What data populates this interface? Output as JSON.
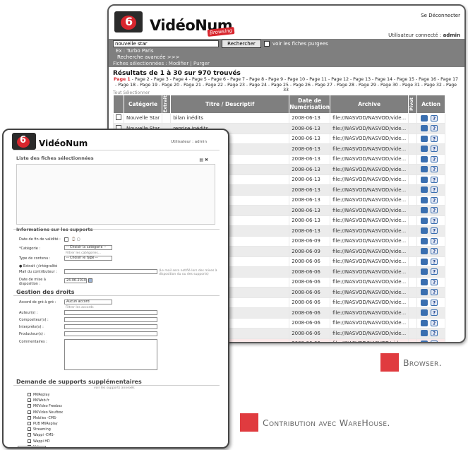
{
  "browser": {
    "logout": "Se Déconnecter",
    "brand": "VidéoNum",
    "brand_sub": "Browsing",
    "user_label": "Utilisateur connecté :",
    "user_name": "admin",
    "search_value": "nouvelle star",
    "search_button": "Rechercher",
    "purge_label": "voir les fiches purgees",
    "example": "Ex : Turbo Paris",
    "advanced": "Recherche avancée >>>",
    "selected_label": "Fiches sélectionnées :",
    "selected_actions": "Modifier | Purger",
    "results_title": "Résultats de 1 à 30 sur 970 trouvés",
    "pages_text": "Page 1 - Page 2 - Page 3 - Page 4 - Page 5 - Page 6 - Page 7 - Page 8 - Page 9 - Page 10 - Page 11 - Page 12 - Page 13 - Page 14 - Page 15 - Page 16 - Page 17 - Page 18 - Page 19 - Page 20 - Page 21 - Page 22 - Page 23 - Page 24 - Page 25 - Page 26 - Page 27 - Page 28 - Page 29 - Page 30 - Page 31 - Page 32 - Page 33",
    "current_page": "Page 1",
    "select_all": "Tout Sélectionner",
    "columns": {
      "category": "Catégorie",
      "extract": "Extrait",
      "title": "Titre / Descriptif",
      "date": "Date de Numérisation",
      "archive": "Archive",
      "pivot": "Pivot",
      "action": "Action"
    },
    "rows": [
      {
        "category": "Nouvelle Star",
        "title": "bilan inédits",
        "date": "2008-06-13",
        "archive": "file://NASVOD/NASVOD/vide..."
      },
      {
        "category": "Nouvelle Star",
        "title": "reprise inédits",
        "date": "2008-06-13",
        "archive": "file://NASVOD/NASVOD/vide..."
      },
      {
        "category": "",
        "title": "",
        "date": "2008-06-13",
        "archive": "file://NASVOD/NASVOD/vide..."
      },
      {
        "category": "",
        "title": "",
        "date": "2008-06-13",
        "archive": "file://NASVOD/NASVOD/vide..."
      },
      {
        "category": "",
        "title": "",
        "date": "2008-06-13",
        "archive": "file://NASVOD/NASVOD/vide..."
      },
      {
        "category": "",
        "title": "",
        "date": "2008-06-13",
        "archive": "file://NASVOD/NASVOD/vide..."
      },
      {
        "category": "",
        "title": "",
        "date": "2008-06-13",
        "archive": "file://NASVOD/NASVOD/vide..."
      },
      {
        "category": "",
        "title": "",
        "date": "2008-06-13",
        "archive": "file://NASVOD/NASVOD/vide..."
      },
      {
        "category": "",
        "title": "",
        "date": "2008-06-13",
        "archive": "file://NASVOD/NASVOD/vide..."
      },
      {
        "category": "",
        "title": "",
        "date": "2008-06-13",
        "archive": "file://NASVOD/NASVOD/vide..."
      },
      {
        "category": "",
        "title": "",
        "date": "2008-06-13",
        "archive": "file://NASVOD/NASVOD/vide..."
      },
      {
        "category": "",
        "title": "",
        "date": "2008-06-13",
        "archive": "file://NASVOD/NASVOD/vide..."
      },
      {
        "category": "",
        "title": "",
        "date": "2008-06-09",
        "archive": "file://NASVOD/NASVOD/vide..."
      },
      {
        "category": "",
        "title": "",
        "date": "2008-06-09",
        "archive": "file://NASVOD/NASVOD/vide..."
      },
      {
        "category": "",
        "title": "",
        "date": "2008-06-06",
        "archive": "file://NASVOD/NASVOD/vide..."
      },
      {
        "category": "",
        "title": "",
        "date": "2008-06-06",
        "archive": "file://NASVOD/NASVOD/vide..."
      },
      {
        "category": "",
        "title": "",
        "date": "2008-06-06",
        "archive": "file://NASVOD/NASVOD/vide..."
      },
      {
        "category": "",
        "title": "",
        "date": "2008-06-06",
        "archive": "file://NASVOD/NASVOD/vide..."
      },
      {
        "category": "",
        "title": "",
        "date": "2008-06-06",
        "archive": "file://NASVOD/NASVOD/vide..."
      },
      {
        "category": "",
        "title": "",
        "date": "2008-06-06",
        "archive": "file://NASVOD/NASVOD/vide..."
      },
      {
        "category": "",
        "title": "",
        "date": "2008-06-06",
        "archive": "file://NASVOD/NASVOD/vide..."
      },
      {
        "category": "",
        "title": "",
        "date": "2008-06-06",
        "archive": "file://NASVOD/NASVOD/vide..."
      },
      {
        "category": "",
        "title": "",
        "date": "2008-06-06",
        "archive": "file://NASVOD/NASVOD/vide..."
      }
    ],
    "purge_button": "urées"
  },
  "contribution": {
    "brand": "VidéoNum",
    "user": "Utilisateur : admin",
    "selected_list_title": "Liste des fiches sélectionnées",
    "supports_title": "Informations sur les supports",
    "end_validity_label": "Date de fin de validité :",
    "category_label": "*Catégorie :",
    "category_value": "-- Choisir la catégorie --",
    "category_sub": "Filtrer les catégories...",
    "content_type_label": "Type de contenu :",
    "content_type_value": "-- Choisir le type --",
    "extract_label": "Extrait",
    "full_label": "Intégralité",
    "email_label": "Mail du contributeur :",
    "email_note": "(Le mail sera notifié lors des mises à disposition du ou des supports)",
    "availability_label": "Date de mise à disposition :",
    "availability_value": "24-06-2010",
    "rights_title": "Gestion des droits",
    "agreement_label": "Accord de gré à gré :",
    "agreement_value": "Aucun accord",
    "agreement_sub": "Filtrer les accords",
    "authors_label": "Auteur(s) :",
    "composers_label": "Compositeur(s) :",
    "performers_label": "Interprète(s) :",
    "producers_label": "Producteur(s) :",
    "comments_label": "Commentaires :",
    "extra_title": "Demande de supports supplémentaires",
    "extra_sub": "voir les supports annexés",
    "extra_options": [
      "M6Replay",
      "M6Web.fr",
      "M6Video Freebox",
      "M6Video Neufbox",
      "Mobiles -CMS-",
      "PUB M6Replay",
      "Streaming",
      "Wappi -CMS-",
      "Wappi HD",
      "Video",
      "Video Nouvelle Star"
    ]
  },
  "captions": {
    "browser": "Browser.",
    "contribution": "Contribution avec WareHouse."
  },
  "colors": {
    "accent": "#e03b3f",
    "header_gray": "#7f7f7f",
    "brand_red": "#d8262e"
  }
}
